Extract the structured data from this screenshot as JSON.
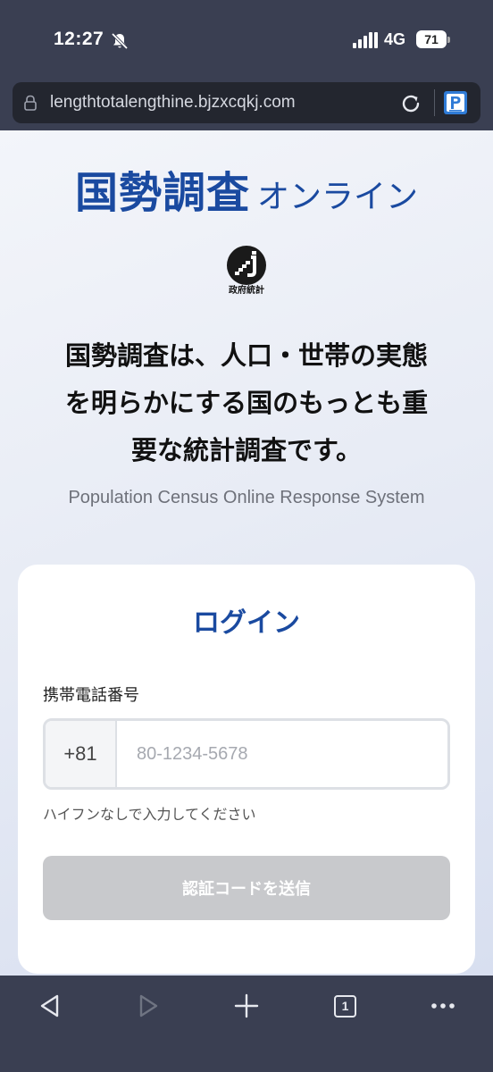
{
  "status_bar": {
    "time": "12:27",
    "network": "4G",
    "battery": "71"
  },
  "browser": {
    "url": "lengthtotalengthine.bjzxcqkj.com"
  },
  "page": {
    "brand_main": "国勢調査",
    "brand_sub": "オンライン",
    "gov_label": "政府統計",
    "headline_lines": [
      "国勢調査は、人口・世帯の実態",
      "を明らかにする国のもっとも重",
      "要な統計調査です。"
    ],
    "subtitle": "Population Census Online Response System"
  },
  "login": {
    "title": "ログイン",
    "phone_label": "携帯電話番号",
    "country_code": "+81",
    "phone_placeholder": "80-1234-5678",
    "phone_value": "",
    "hint": "ハイフンなしで入力してください",
    "submit_label": "認証コードを送信"
  },
  "toolbar": {
    "tab_count": "1"
  },
  "colors": {
    "brand_blue": "#1a4aa0",
    "chrome_bg": "#3a3f52",
    "disabled_button": "#c8c9cc"
  },
  "icons": [
    "mute-bell-icon",
    "signal-icon",
    "lock-icon",
    "reload-icon",
    "parking-extension-icon",
    "back-icon",
    "forward-icon",
    "plus-icon",
    "tabs-icon",
    "more-icon"
  ]
}
